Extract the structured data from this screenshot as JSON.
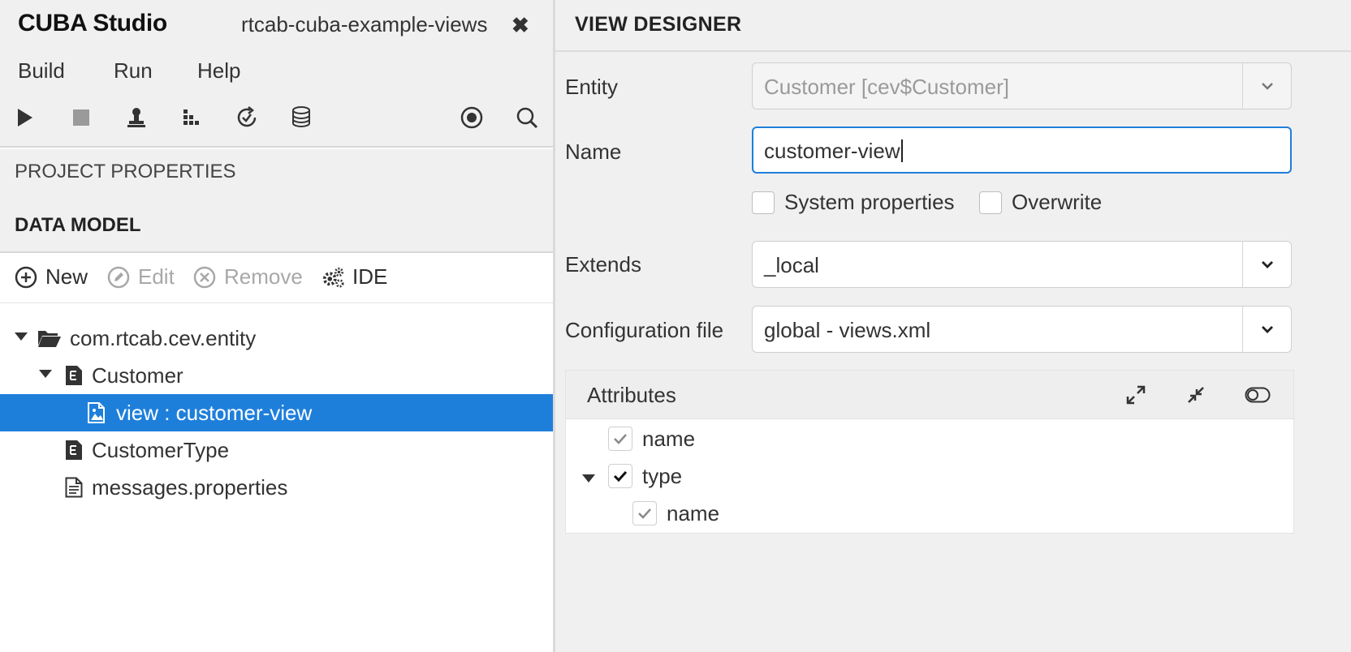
{
  "app": {
    "title": "CUBA Studio",
    "project": "rtcab-cuba-example-views",
    "close_glyph": "✖"
  },
  "menu": [
    "Build",
    "Run",
    "Help"
  ],
  "toolbar_icons": [
    "run-icon",
    "stop-icon",
    "deploy-icon",
    "build-icon",
    "update-icon",
    "database-icon",
    "record-icon",
    "search-icon"
  ],
  "sections": {
    "project_properties": "PROJECT PROPERTIES",
    "data_model": "DATA MODEL"
  },
  "data_model_toolbar": {
    "new": "New",
    "edit": "Edit",
    "remove": "Remove",
    "ide": "IDE"
  },
  "tree": [
    {
      "label": "com.rtcab.cev.entity",
      "icon": "folder-open-icon",
      "expanded": true
    },
    {
      "label": "Customer",
      "icon": "entity-icon",
      "expanded": true
    },
    {
      "label": "view : customer-view",
      "icon": "view-icon",
      "selected": true
    },
    {
      "label": "CustomerType",
      "icon": "entity-icon"
    },
    {
      "label": "messages.properties",
      "icon": "file-icon"
    }
  ],
  "view_designer": {
    "title": "VIEW DESIGNER",
    "entity_label": "Entity",
    "entity_value": "Customer [cev$Customer]",
    "name_label": "Name",
    "name_value": "customer-view",
    "system_properties_label": "System properties",
    "overwrite_label": "Overwrite",
    "system_properties_checked": false,
    "overwrite_checked": false,
    "extends_label": "Extends",
    "extends_value": "_local",
    "config_label": "Configuration file",
    "config_value": "global - views.xml",
    "attributes_title": "Attributes",
    "attributes": [
      {
        "name": "name",
        "checked": true,
        "disabled": true
      },
      {
        "name": "type",
        "checked": true,
        "disabled": false,
        "expanded": true
      },
      {
        "name": "name",
        "checked": true,
        "disabled": true
      }
    ]
  },
  "colors": {
    "accent": "#1e7fdb",
    "panel_bg": "#f0f0f0",
    "disabled_text": "#a8a8a8"
  }
}
